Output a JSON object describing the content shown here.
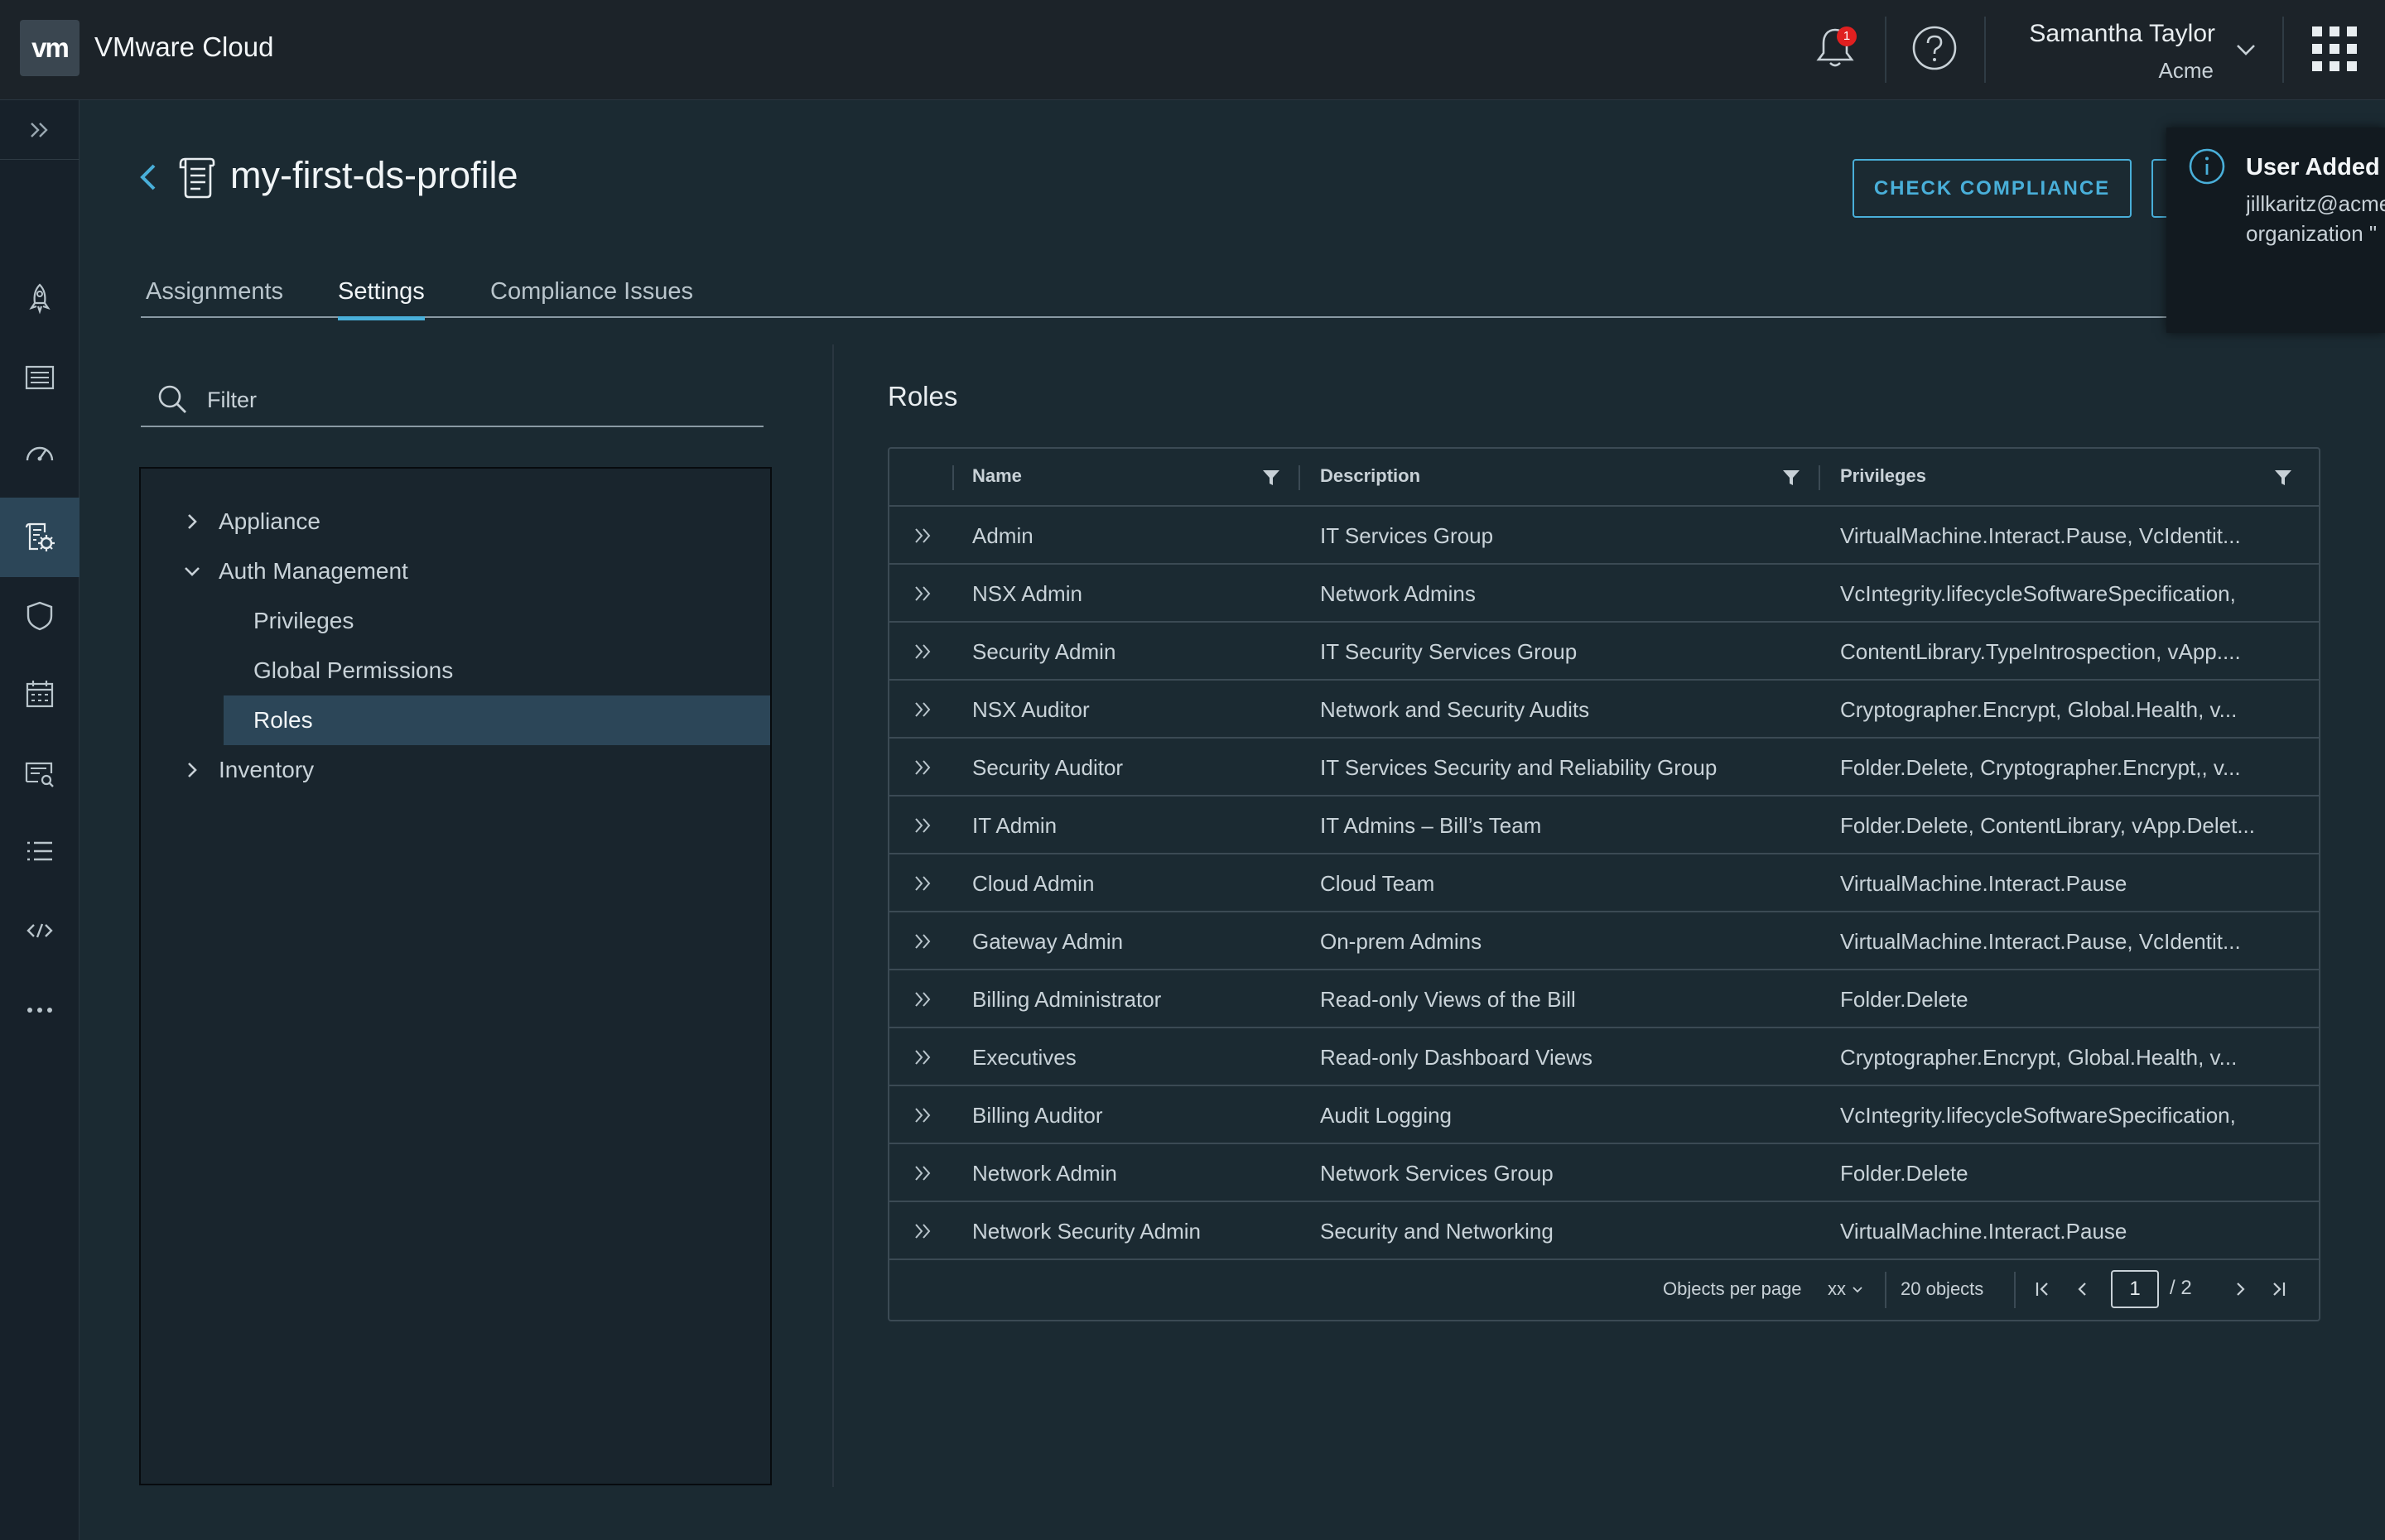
{
  "header": {
    "logo_text": "vm",
    "app_title": "VMware Cloud",
    "notification_count": "1",
    "user_name": "Samantha Taylor",
    "user_org": "Acme"
  },
  "nav": {
    "items": [
      "expand-icon",
      "rocket-icon",
      "list-view-icon",
      "dashboard-icon",
      "profile-settings-icon",
      "shield-icon",
      "calendar-icon",
      "review-icon",
      "bullet-list-icon",
      "code-icon",
      "more-icon"
    ],
    "active_index": 4
  },
  "page": {
    "title": "my-first-ds-profile",
    "check_compliance_label": "CHECK COMPLIANCE"
  },
  "tabs": [
    {
      "label": "Assignments"
    },
    {
      "label": "Settings",
      "active": true
    },
    {
      "label": "Compliance Issues"
    }
  ],
  "filter": {
    "placeholder": "Filter"
  },
  "tree": [
    {
      "label": "Appliance",
      "type": "folder",
      "expanded": false
    },
    {
      "label": "Auth Management",
      "type": "folder",
      "expanded": true
    },
    {
      "label": "Privileges",
      "type": "leaf"
    },
    {
      "label": "Global Permissions",
      "type": "leaf"
    },
    {
      "label": "Roles",
      "type": "leaf",
      "selected": true
    },
    {
      "label": "Inventory",
      "type": "folder",
      "expanded": false
    }
  ],
  "roles": {
    "title": "Roles",
    "columns": [
      "Name",
      "Description",
      "Privileges"
    ],
    "rows": [
      {
        "name": "Admin",
        "description": "IT Services Group",
        "privileges": "VirtualMachine.Interact.Pause, VcIdentit..."
      },
      {
        "name": "NSX Admin",
        "description": "Network Admins",
        "privileges": "VcIntegrity.lifecycleSoftwareSpecification,"
      },
      {
        "name": "Security Admin",
        "description": "IT Security Services Group",
        "privileges": "ContentLibrary.TypeIntrospection, vApp...."
      },
      {
        "name": "NSX Auditor",
        "description": "Network and Security Audits",
        "privileges": "Cryptographer.Encrypt, Global.Health, v..."
      },
      {
        "name": "Security Auditor",
        "description": "IT Services Security and Reliability Group",
        "privileges": "Folder.Delete, Cryptographer.Encrypt,, v..."
      },
      {
        "name": "IT Admin",
        "description": "IT Admins – Bill’s Team",
        "privileges": "Folder.Delete, ContentLibrary, vApp.Delet..."
      },
      {
        "name": "Cloud Admin",
        "description": "Cloud Team",
        "privileges": "VirtualMachine.Interact.Pause"
      },
      {
        "name": "Gateway Admin",
        "description": "On-prem Admins",
        "privileges": "VirtualMachine.Interact.Pause, VcIdentit..."
      },
      {
        "name": "Billing Administrator",
        "description": "Read-only Views of the Bill",
        "privileges": "Folder.Delete"
      },
      {
        "name": "Executives",
        "description": "Read-only Dashboard Views",
        "privileges": "Cryptographer.Encrypt, Global.Health, v..."
      },
      {
        "name": "Billing Auditor",
        "description": "Audit Logging",
        "privileges": "VcIntegrity.lifecycleSoftwareSpecification,"
      },
      {
        "name": "Network Admin",
        "description": "Network Services Group",
        "privileges": "Folder.Delete"
      },
      {
        "name": "Network Security Admin",
        "description": "Security and Networking",
        "privileges": "VirtualMachine.Interact.Pause"
      }
    ],
    "footer": {
      "per_page_label": "Objects per page",
      "per_page_value": "xx",
      "object_count": "20 objects",
      "current_page": "1",
      "total_pages": "/ 2"
    }
  },
  "toast": {
    "title": "User Added",
    "line1": "jillkaritz@acme",
    "line2": "organization \""
  }
}
